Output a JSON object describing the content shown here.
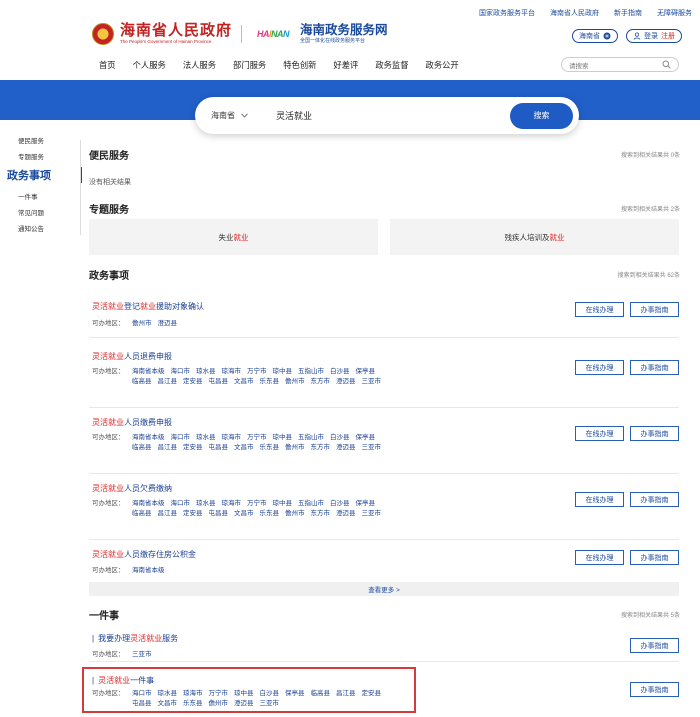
{
  "topbar": {
    "links": [
      "国家政务服务平台",
      "海南省人民政府",
      "新手指南",
      "无障碍服务"
    ]
  },
  "brand": {
    "gov_title": "海南省人民政府",
    "gov_sub": "The People's Government of Hainan Province",
    "hainan_letters": [
      "HA",
      "I",
      "NA",
      "N"
    ],
    "svc_title": "海南政务服务网",
    "svc_sub": "全国一体化在线政务服务平台"
  },
  "account": {
    "region": "海南省",
    "login": "登录",
    "register": "注册"
  },
  "nav": [
    "首页",
    "个人服务",
    "法人服务",
    "部门服务",
    "特色创新",
    "好差评",
    "政务监督",
    "政务公开"
  ],
  "top_search": {
    "placeholder": "请搜索"
  },
  "search": {
    "region": "海南省",
    "keyword": "灵活就业",
    "button": "搜索"
  },
  "sidebar": {
    "items": [
      "便民服务",
      "专题服务",
      "政务事项",
      "一件事",
      "常见问题",
      "通知公告"
    ]
  },
  "sections": {
    "bianmin": {
      "title": "便民服务",
      "count": "搜索到相关结果共 0条",
      "empty": "没有相关结果"
    },
    "zhuanti": {
      "title": "专题服务",
      "count": "搜索到相关结果共 2条",
      "topics": [
        {
          "pre": "失业",
          "hl": "就业",
          "post": ""
        },
        {
          "pre": "残疾人培训及",
          "hl": "就业",
          "post": ""
        }
      ]
    },
    "zhengwu": {
      "title": "政务事项",
      "count": "搜索到相关结果共 62条"
    },
    "yijianshi": {
      "title": "一件事",
      "count": "搜索到相关结果共 5条"
    }
  },
  "labels": {
    "area": "可办地区：",
    "online": "在线办理",
    "guide": "办事指南",
    "more": "查看更多 >"
  },
  "matters": [
    {
      "hl": "灵活就业",
      "mid": "登记",
      "hl2": "就业",
      "post": "援助对象确认",
      "areas": [
        "儋州市",
        "澄迈县"
      ]
    },
    {
      "hl": "灵活就业",
      "post": "人员退费申报",
      "areas": [
        "海南省本级",
        "海口市",
        "琼水县",
        "琼海市",
        "万宁市",
        "琼中县",
        "五指山市",
        "白沙县",
        "保亭县",
        "临高县",
        "昌江县",
        "定安县",
        "屯昌县",
        "文昌市",
        "乐东县",
        "儋州市",
        "东方市",
        "澄迈县",
        "三亚市"
      ]
    },
    {
      "hl": "灵活就业",
      "post": "人员缴费申报",
      "areas": [
        "海南省本级",
        "海口市",
        "琼水县",
        "琼海市",
        "万宁市",
        "琼中县",
        "五指山市",
        "白沙县",
        "保亭县",
        "临高县",
        "昌江县",
        "定安县",
        "屯昌县",
        "文昌市",
        "乐东县",
        "儋州市",
        "东方市",
        "澄迈县",
        "三亚市"
      ]
    },
    {
      "hl": "灵活就业",
      "post": "人员欠费缴纳",
      "areas": [
        "海南省本级",
        "海口市",
        "琼水县",
        "琼海市",
        "万宁市",
        "琼中县",
        "五指山市",
        "白沙县",
        "保亭县",
        "临高县",
        "昌江县",
        "定安县",
        "屯昌县",
        "文昌市",
        "乐东县",
        "儋州市",
        "东方市",
        "澄迈县",
        "三亚市"
      ]
    },
    {
      "hl": "灵活就业",
      "post": "人员缴存住房公积金",
      "areas": [
        "海南省本级"
      ]
    }
  ],
  "things": [
    {
      "pre": "我要办理",
      "hl": "灵活就业",
      "post": "服务",
      "areas": [
        "三亚市"
      ]
    },
    {
      "pre": "",
      "hl": "灵活就业",
      "post": "一件事",
      "areas": [
        "海口市",
        "琼水县",
        "琼海市",
        "万宁市",
        "琼中县",
        "白沙县",
        "保亭县",
        "临高县",
        "昌江县",
        "定安县",
        "屯昌县",
        "文昌市",
        "乐东县",
        "儋州市",
        "澄迈县",
        "三亚市"
      ]
    }
  ]
}
